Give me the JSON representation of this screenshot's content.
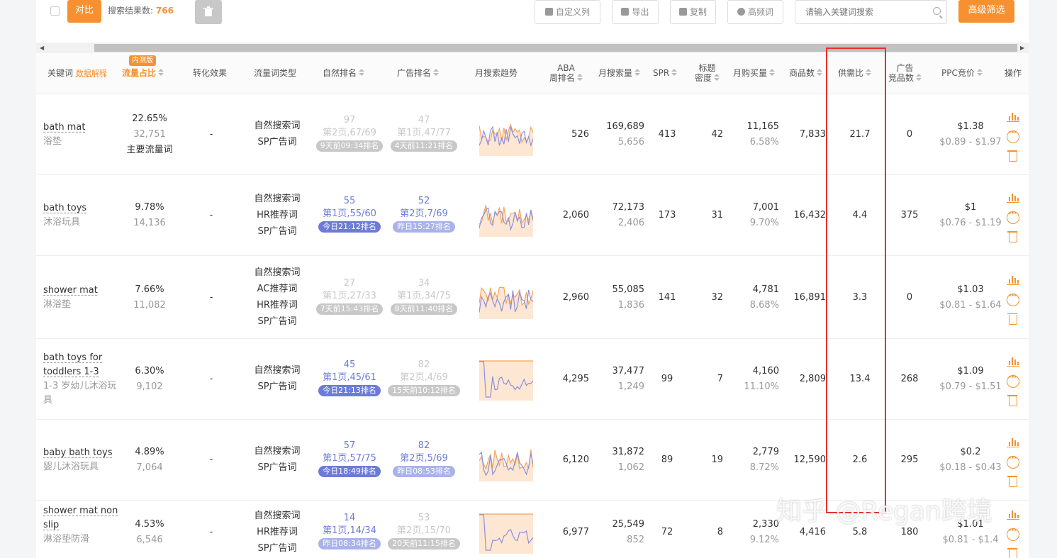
{
  "toolbar": {
    "compare_label": "对比",
    "result_label": "搜索结果数:",
    "result_count": "766",
    "custom_cols_label": "自定义列",
    "export_label": "导出",
    "copy_label": "复制",
    "high_freq_label": "高频词",
    "search_placeholder": "请输入关键词搜索",
    "advanced_filter_label": "高级筛选"
  },
  "header": {
    "keyword": "关键词",
    "data_explain": "数据解释",
    "beta_badge": "内测版",
    "traffic_share": "流量占比",
    "conversion": "转化效果",
    "traffic_type": "流量词类型",
    "organic_rank": "自然排名",
    "ad_rank": "广告排名",
    "monthly_trend": "月搜索趋势",
    "aba_line1": "ABA",
    "aba_line2": "周排名",
    "monthly_search": "月搜索量",
    "spr": "SPR",
    "title_density_line1": "标题",
    "title_density_line2": "密度",
    "monthly_purchase": "月购买量",
    "product_count": "商品数",
    "supply_demand": "供需比",
    "ad_products_line1": "广告",
    "ad_products_line2": "竞品数",
    "ppc_bid": "PPC竞价",
    "actions": "操作"
  },
  "rows": [
    {
      "kw_en": "bath mat",
      "kw_cn": "浴垫",
      "share_pct": "22.65%",
      "share_num": "32,751",
      "share_note": "主要流量词",
      "conversion": "-",
      "types": [
        "自然搜索词",
        "SP广告词"
      ],
      "organic": {
        "num": "97",
        "page": "第2页,67/69",
        "badge": "9天前09:34排名"
      },
      "ad": {
        "num": "47",
        "page": "第1页,47/77",
        "badge": "4天前11:21排名"
      },
      "aba": "526",
      "search_vol": "169,689",
      "search_sub": "5,656",
      "spr": "413",
      "density": "42",
      "purchase": "11,165",
      "purchase_pct": "6.58%",
      "products": "7,833",
      "supply_demand": "21.7",
      "ad_products": "0",
      "ppc": "$1.38",
      "ppc_range": "$0.89 - $1.97"
    },
    {
      "kw_en": "bath toys",
      "kw_cn": "沐浴玩具",
      "share_pct": "9.78%",
      "share_num": "14,136",
      "share_note": "",
      "conversion": "-",
      "types": [
        "自然搜索词",
        "HR推荐词",
        "SP广告词"
      ],
      "organic": {
        "num": "55",
        "page": "第1页,55/60",
        "badge": "今日21:12排名"
      },
      "ad": {
        "num": "52",
        "page": "第2页,7/69",
        "badge": "昨日15:27排名"
      },
      "aba": "2,060",
      "search_vol": "72,173",
      "search_sub": "2,406",
      "spr": "173",
      "density": "31",
      "purchase": "7,001",
      "purchase_pct": "9.70%",
      "products": "16,432",
      "supply_demand": "4.4",
      "ad_products": "375",
      "ppc": "$1",
      "ppc_range": "$0.76 - $1.19"
    },
    {
      "kw_en": "shower mat",
      "kw_cn": "淋浴垫",
      "share_pct": "7.66%",
      "share_num": "11,082",
      "share_note": "",
      "conversion": "-",
      "types": [
        "自然搜索词",
        "AC推荐词",
        "HR推荐词",
        "SP广告词"
      ],
      "organic": {
        "num": "27",
        "page": "第1页,27/33",
        "badge": "7天前15:43排名"
      },
      "ad": {
        "num": "34",
        "page": "第1页,34/75",
        "badge": "8天前11:40排名"
      },
      "aba": "2,960",
      "search_vol": "55,085",
      "search_sub": "1,836",
      "spr": "141",
      "density": "32",
      "purchase": "4,781",
      "purchase_pct": "8.68%",
      "products": "16,891",
      "supply_demand": "3.3",
      "ad_products": "0",
      "ppc": "$1.03",
      "ppc_range": "$0.81 - $1.64"
    },
    {
      "kw_en": "bath toys for toddlers 1-3",
      "kw_cn": "1-3 岁幼儿沐浴玩具",
      "share_pct": "6.30%",
      "share_num": "9,102",
      "share_note": "",
      "conversion": "-",
      "types": [
        "自然搜索词",
        "SP广告词"
      ],
      "organic": {
        "num": "45",
        "page": "第1页,45/61",
        "badge": "今日21:13排名"
      },
      "ad": {
        "num": "82",
        "page": "第2页,4/69",
        "badge": "15天前10:12排名"
      },
      "aba": "4,295",
      "search_vol": "37,477",
      "search_sub": "1,249",
      "spr": "99",
      "density": "7",
      "purchase": "4,160",
      "purchase_pct": "11.10%",
      "products": "2,809",
      "supply_demand": "13.4",
      "ad_products": "268",
      "ppc": "$1.09",
      "ppc_range": "$0.79 - $1.51"
    },
    {
      "kw_en": "baby bath toys",
      "kw_cn": "婴儿沐浴玩具",
      "share_pct": "4.89%",
      "share_num": "7,064",
      "share_note": "",
      "conversion": "-",
      "types": [
        "自然搜索词",
        "SP广告词"
      ],
      "organic": {
        "num": "57",
        "page": "第1页,57/75",
        "badge": "今日18:49排名"
      },
      "ad": {
        "num": "82",
        "page": "第2页,5/69",
        "badge": "昨日08:53排名"
      },
      "aba": "6,120",
      "search_vol": "31,872",
      "search_sub": "1,062",
      "spr": "89",
      "density": "19",
      "purchase": "2,779",
      "purchase_pct": "8.72%",
      "products": "12,590",
      "supply_demand": "2.6",
      "ad_products": "295",
      "ppc": "$0.2",
      "ppc_range": "$0.18 - $0.43"
    },
    {
      "kw_en": "shower mat non slip",
      "kw_cn": "淋浴垫防滑",
      "share_pct": "4.53%",
      "share_num": "6,546",
      "share_note": "",
      "conversion": "-",
      "types": [
        "自然搜索词",
        "HR推荐词",
        "SP广告词"
      ],
      "organic": {
        "num": "14",
        "page": "第1页,14/34",
        "badge": "昨日08:34排名"
      },
      "ad": {
        "num": "53",
        "page": "第2页,15/70",
        "badge": "20天前11:15排名"
      },
      "aba": "6,977",
      "search_vol": "25,549",
      "search_sub": "852",
      "spr": "72",
      "density": "8",
      "purchase": "2,330",
      "purchase_pct": "9.12%",
      "products": "4,416",
      "supply_demand": "5.8",
      "ad_products": "180",
      "ppc": "$1.01",
      "ppc_range": "$0.81 - $1.4"
    }
  ],
  "watermark": "知乎 @Regan跨境",
  "colors": {
    "accent": "#f7912f",
    "rank_blue": "#6c7bd8",
    "highlight_red": "#e8312c"
  }
}
